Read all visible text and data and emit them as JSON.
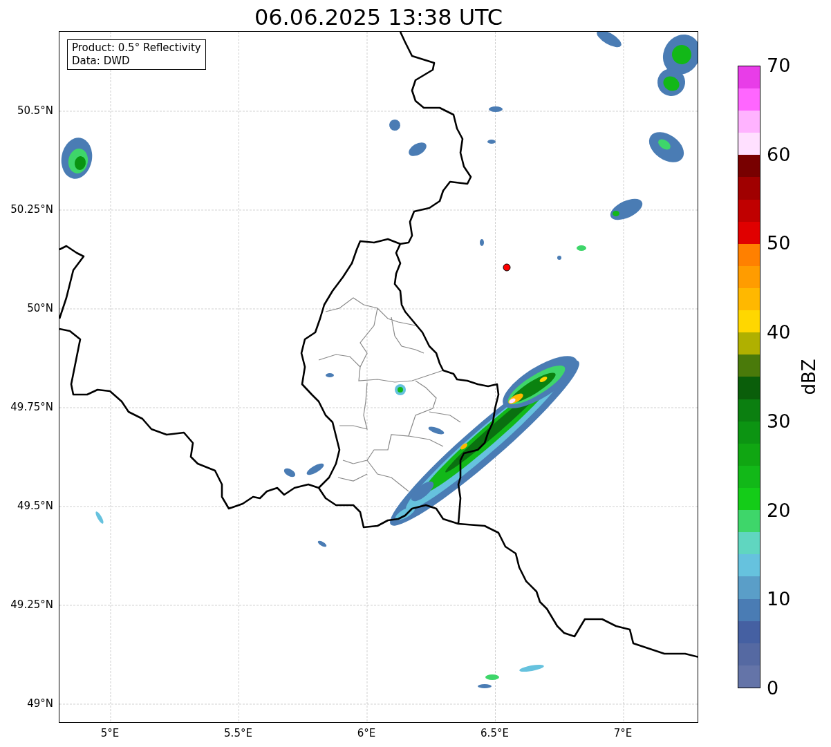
{
  "title": "06.06.2025 13:38 UTC",
  "info_box": {
    "lines": [
      "Product: 0.5° Reflectivity",
      "Data: DWD"
    ]
  },
  "y_ticks": [
    "50.5°N",
    "50.25°N",
    "50°N",
    "49.75°N",
    "49.5°N",
    "49.25°N",
    "49°N"
  ],
  "x_ticks": [
    "5°E",
    "5.5°E",
    "6°E",
    "6.5°E",
    "7°E"
  ],
  "colorbar": {
    "label": "dBZ",
    "ticks": [
      "70",
      "60",
      "50",
      "40",
      "30",
      "20",
      "10",
      "0"
    ],
    "bands": [
      {
        "color": "#6474a8"
      },
      {
        "color": "#5569a2"
      },
      {
        "color": "#4560a2"
      },
      {
        "color": "#4a7cb4"
      },
      {
        "color": "#5a9ec8"
      },
      {
        "color": "#66c2de"
      },
      {
        "color": "#60d6c0"
      },
      {
        "color": "#3ed66a"
      },
      {
        "color": "#14cc18"
      },
      {
        "color": "#12b818"
      },
      {
        "color": "#10a612"
      },
      {
        "color": "#0c9412"
      },
      {
        "color": "#0b7f10"
      },
      {
        "color": "#0a5e0a"
      },
      {
        "color": "#4a7a0a"
      },
      {
        "color": "#b0b000"
      },
      {
        "color": "#ffd700"
      },
      {
        "color": "#ffb800"
      },
      {
        "color": "#ff9c00"
      },
      {
        "color": "#ff8000"
      },
      {
        "color": "#e00000"
      },
      {
        "color": "#c00000"
      },
      {
        "color": "#a00000"
      },
      {
        "color": "#780000"
      },
      {
        "color": "#ffe0ff"
      },
      {
        "color": "#ffb3ff"
      },
      {
        "color": "#ff66ff"
      },
      {
        "color": "#e83de8"
      }
    ]
  }
}
